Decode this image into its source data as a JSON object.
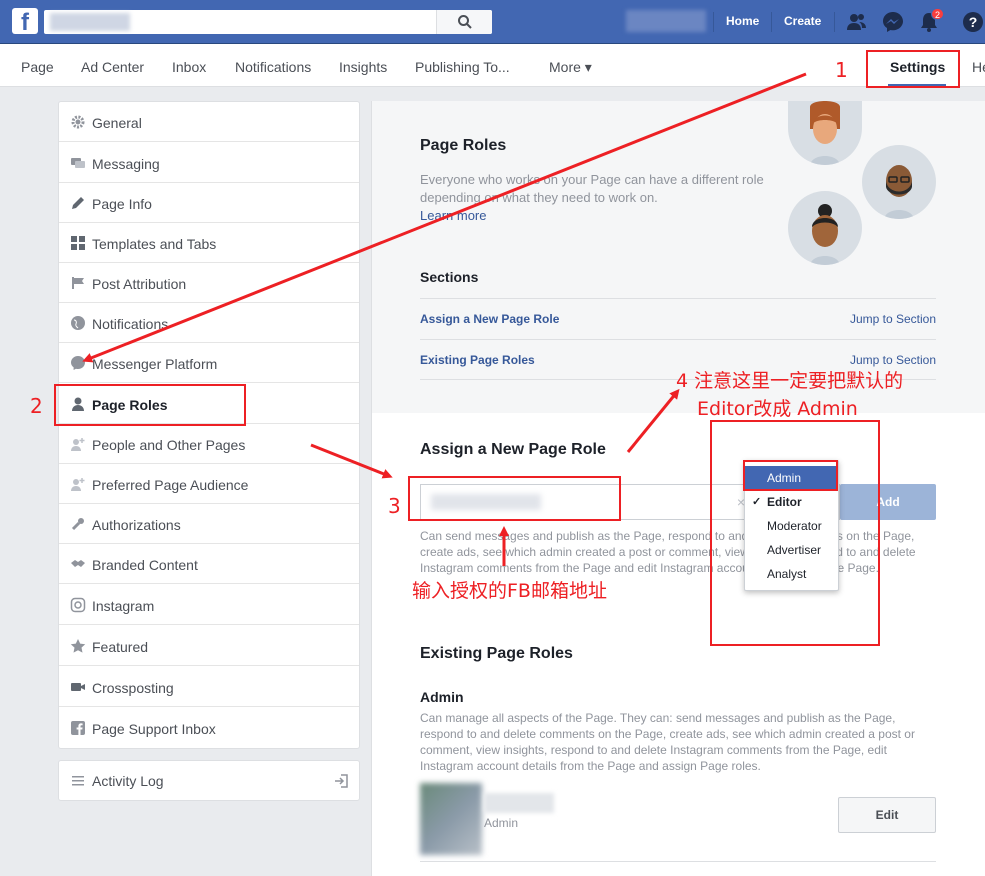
{
  "topbar": {
    "logo": "f",
    "nav": [
      "Home",
      "Create"
    ],
    "notification_count": "2",
    "icons": [
      "friends-icon",
      "messenger-icon",
      "notifications-icon",
      "help-icon"
    ]
  },
  "page_tabs": [
    {
      "label": "Page"
    },
    {
      "label": "Ad Center"
    },
    {
      "label": "Inbox"
    },
    {
      "label": "Notifications"
    },
    {
      "label": "Insights"
    },
    {
      "label": "Publishing To..."
    },
    {
      "label": "More ▾"
    },
    {
      "label": "Settings"
    },
    {
      "label": "He"
    }
  ],
  "sidebar": {
    "items": [
      {
        "label": "General",
        "icon": "gear-icon"
      },
      {
        "label": "Messaging",
        "icon": "chat-icon"
      },
      {
        "label": "Page Info",
        "icon": "pencil-icon"
      },
      {
        "label": "Templates and Tabs",
        "icon": "grid-icon"
      },
      {
        "label": "Post Attribution",
        "icon": "flag-icon"
      },
      {
        "label": "Notifications",
        "icon": "globe-icon"
      },
      {
        "label": "Messenger Platform",
        "icon": "messenger-icon"
      },
      {
        "label": "Page Roles",
        "icon": "person-icon"
      },
      {
        "label": "People and Other Pages",
        "icon": "people-icon"
      },
      {
        "label": "Preferred Page Audience",
        "icon": "people-icon"
      },
      {
        "label": "Authorizations",
        "icon": "wrench-icon"
      },
      {
        "label": "Branded Content",
        "icon": "handshake-icon"
      },
      {
        "label": "Instagram",
        "icon": "instagram-icon"
      },
      {
        "label": "Featured",
        "icon": "star-icon"
      },
      {
        "label": "Crossposting",
        "icon": "video-icon"
      },
      {
        "label": "Page Support Inbox",
        "icon": "facebook-icon"
      }
    ],
    "activity_log": "Activity Log"
  },
  "page_roles": {
    "title": "Page Roles",
    "description": "Everyone who works on your Page can have a different role depending on what they need to work on.",
    "learn_more": "Learn more",
    "sections_title": "Sections",
    "sections": [
      {
        "label": "Assign a New Page Role",
        "jump": "Jump to Section"
      },
      {
        "label": "Existing Page Roles",
        "jump": "Jump to Section"
      }
    ]
  },
  "assign": {
    "title": "Assign a New Page Role",
    "clear": "×",
    "add_label": "Add",
    "description": "Can send messages and publish as the Page, respond to and delete comments on the Page, create ads, see which admin created a post or comment, view insights, respond to and delete Instagram comments from the Page and edit Instagram account details from the Page."
  },
  "role_dropdown": {
    "options": [
      "Admin",
      "Editor",
      "Moderator",
      "Advertiser",
      "Analyst"
    ],
    "highlighted": "Admin",
    "checked": "Editor",
    "check_mark": "✓"
  },
  "existing": {
    "title": "Existing Page Roles",
    "role": "Admin",
    "role_description": "Can manage all aspects of the Page. They can: send messages and publish as the Page, respond to and delete comments on the Page, create ads, see which admin created a post or comment, view insights, respond to and delete Instagram comments from the Page, edit Instagram account details from the Page and assign Page roles.",
    "user_role": "Admin",
    "edit_label": "Edit"
  },
  "annotations": {
    "step1": "1",
    "step2": "2",
    "step3": "3",
    "step4": "4 注意这里一定要把默认的",
    "step4_line2": "Editor改成 Admin",
    "email_hint": "输入授权的FB邮箱地址",
    "color": "#ed2024"
  }
}
